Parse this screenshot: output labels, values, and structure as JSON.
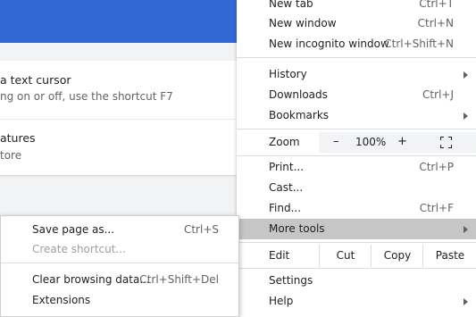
{
  "background": {
    "partial_header_text": "",
    "caret_title": "a text cursor",
    "caret_sub": "ng on or off, use the shortcut F7",
    "features_title": "atures",
    "features_sub": "tore"
  },
  "menu": {
    "new_tab": {
      "label": "New tab",
      "shortcut": "Ctrl+T"
    },
    "new_window": {
      "label": "New window",
      "shortcut": "Ctrl+N"
    },
    "new_incognito": {
      "label": "New incognito window",
      "shortcut": "Ctrl+Shift+N"
    },
    "history": {
      "label": "History"
    },
    "downloads": {
      "label": "Downloads",
      "shortcut": "Ctrl+J"
    },
    "bookmarks": {
      "label": "Bookmarks"
    },
    "zoom": {
      "label": "Zoom",
      "minus": "–",
      "value": "100%",
      "plus": "+"
    },
    "print": {
      "label": "Print...",
      "shortcut": "Ctrl+P"
    },
    "cast": {
      "label": "Cast..."
    },
    "find": {
      "label": "Find...",
      "shortcut": "Ctrl+F"
    },
    "more_tools": {
      "label": "More tools"
    },
    "edit": {
      "label": "Edit",
      "cut": "Cut",
      "copy": "Copy",
      "paste": "Paste"
    },
    "settings": {
      "label": "Settings"
    },
    "help": {
      "label": "Help"
    }
  },
  "submenu": {
    "save_page": {
      "label": "Save page as...",
      "shortcut": "Ctrl+S"
    },
    "create_shortcut": {
      "label": "Create shortcut..."
    },
    "clear_browsing": {
      "label": "Clear browsing data...",
      "shortcut": "Ctrl+Shift+Del"
    },
    "extensions": {
      "label": "Extensions"
    }
  },
  "colors": {
    "header_blue": "#3367d6",
    "highlight": "#c6c6c6"
  }
}
